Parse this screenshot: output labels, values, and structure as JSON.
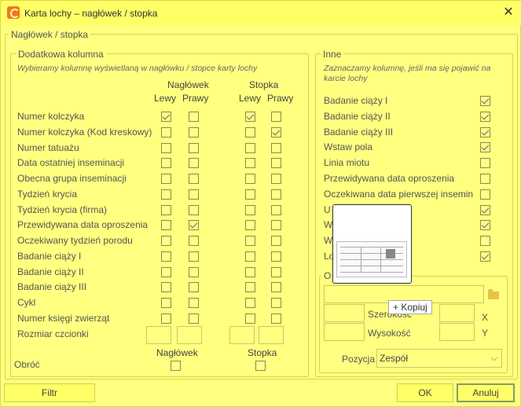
{
  "window": {
    "title": "Karta lochy – nagłówek / stopka",
    "close_glyph": "✕"
  },
  "outer_group": {
    "title": "Nagłówek / stopka"
  },
  "left_group": {
    "title": "Dodatkowa kolumna",
    "hint": "Wybieramy kolumnę wyświetlaną w nagłówku / stopce karty lochy",
    "header_label": "Nagłówek",
    "footer_label": "Stopka",
    "left_label": "Lewy",
    "right_label": "Prawy",
    "rows": [
      {
        "label": "Numer kolczyka",
        "h_left": true,
        "h_right": false,
        "f_left": true,
        "f_right": false
      },
      {
        "label": "Numer kolczyka (Kod kreskowy)",
        "h_left": false,
        "h_right": false,
        "f_left": false,
        "f_right": true
      },
      {
        "label": "Numer tatuażu",
        "h_left": false,
        "h_right": false,
        "f_left": false,
        "f_right": false
      },
      {
        "label": "Data ostatniej inseminacji",
        "h_left": false,
        "h_right": false,
        "f_left": false,
        "f_right": false
      },
      {
        "label": "Obecna grupa inseminacji",
        "h_left": false,
        "h_right": false,
        "f_left": false,
        "f_right": false
      },
      {
        "label": "Tydzień krycia",
        "h_left": false,
        "h_right": false,
        "f_left": false,
        "f_right": false
      },
      {
        "label": "Tydzień krycia (firma)",
        "h_left": false,
        "h_right": false,
        "f_left": false,
        "f_right": false
      },
      {
        "label": "Przewidywana data oproszenia",
        "h_left": false,
        "h_right": true,
        "f_left": false,
        "f_right": false
      },
      {
        "label": "Oczekiwany tydzień porodu",
        "h_left": false,
        "h_right": false,
        "f_left": false,
        "f_right": false
      },
      {
        "label": "Badanie ciąży I",
        "h_left": false,
        "h_right": false,
        "f_left": false,
        "f_right": false
      },
      {
        "label": "Badanie ciąży II",
        "h_left": false,
        "h_right": false,
        "f_left": false,
        "f_right": false
      },
      {
        "label": "Badanie ciąży III",
        "h_left": false,
        "h_right": false,
        "f_left": false,
        "f_right": false
      },
      {
        "label": "Cykl",
        "h_left": false,
        "h_right": false,
        "f_left": false,
        "f_right": false
      },
      {
        "label": "Numer księgi zwierząt",
        "h_left": false,
        "h_right": false,
        "f_left": false,
        "f_right": false
      }
    ],
    "font_size_label": "Rozmiar czcionki",
    "rotate_label": "Obróć",
    "rotate_header_label": "Nagłówek",
    "rotate_footer_label": "Stopka"
  },
  "right_group": {
    "title": "Inne",
    "hint": "Zaznaczamy kolumnę, jeśli ma się pojawić na karcie lochy",
    "rows": [
      {
        "label": "Badanie ciąży I",
        "checked": true
      },
      {
        "label": "Badanie ciąży II",
        "checked": true
      },
      {
        "label": "Badanie ciąży III",
        "checked": true
      },
      {
        "label": "Wstaw pola",
        "checked": true
      },
      {
        "label": "Linia miotu",
        "checked": false
      },
      {
        "label": "Przewidywana data oproszenia",
        "checked": false
      },
      {
        "label": "Oczekiwana data pierwszej insemin",
        "checked": false
      },
      {
        "label": "U",
        "checked": true
      },
      {
        "label": "W",
        "checked": true
      },
      {
        "label": "W",
        "checked": false
      },
      {
        "label": "Lo",
        "checked": true
      }
    ],
    "subgroup_title_partial": "O",
    "width_label": "Szerokość",
    "height_label": "Wysokość",
    "x_label": "X",
    "y_label": "Y",
    "position_label": "Pozycja",
    "position_value": "Zespół"
  },
  "drag": {
    "tooltip": "+ Kopiuj"
  },
  "buttons": {
    "filter": "Filtr",
    "ok": "OK",
    "cancel": "Anuluj"
  }
}
